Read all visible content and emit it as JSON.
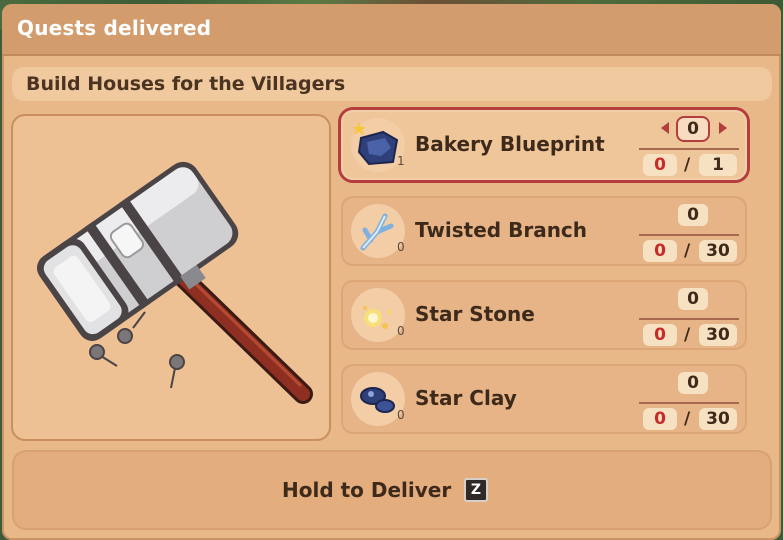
{
  "header": {
    "title": "Quests delivered"
  },
  "quest": {
    "title": "Build Houses for the Villagers"
  },
  "items": [
    {
      "name": "Bakery Blueprint",
      "owned": "1",
      "deliver": "0",
      "current": "0",
      "required": "1",
      "selected": true,
      "icon": "blueprint-icon"
    },
    {
      "name": "Twisted Branch",
      "owned": "0",
      "deliver": "0",
      "current": "0",
      "required": "30",
      "selected": false,
      "icon": "branch-icon"
    },
    {
      "name": "Star Stone",
      "owned": "0",
      "deliver": "0",
      "current": "0",
      "required": "30",
      "selected": false,
      "icon": "star-stone-icon"
    },
    {
      "name": "Star Clay",
      "owned": "0",
      "deliver": "0",
      "current": "0",
      "required": "30",
      "selected": false,
      "icon": "clay-icon"
    }
  ],
  "progress_separator": "/",
  "deliver": {
    "label": "Hold to Deliver",
    "key": "Z"
  },
  "colors": {
    "accent": "#b43d3d",
    "panel": "#e8b888",
    "text": "#3e2a1b",
    "missing": "#c82a2a"
  }
}
